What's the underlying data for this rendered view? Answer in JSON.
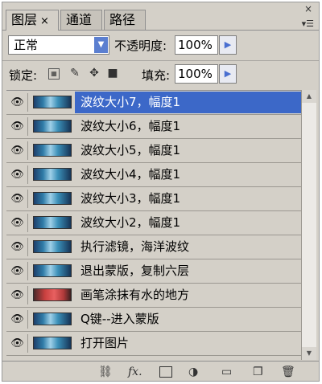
{
  "tabs": [
    {
      "label": "图层",
      "close": "×"
    },
    {
      "label": "通道"
    },
    {
      "label": "路径"
    }
  ],
  "panel_close": "×",
  "panel_menu": "▾☰",
  "blend_mode": {
    "value": "正常"
  },
  "opacity": {
    "label": "不透明度:",
    "value": "100%"
  },
  "lock": {
    "label": "锁定:"
  },
  "fill": {
    "label": "填充:",
    "value": "100%"
  },
  "layers": [
    {
      "name": "波纹大小7，幅度1",
      "selected": true
    },
    {
      "name": "波纹大小6，幅度1"
    },
    {
      "name": "波纹大小5，幅度1"
    },
    {
      "name": "波纹大小4，幅度1"
    },
    {
      "name": "波纹大小3，幅度1"
    },
    {
      "name": "波纹大小2，幅度1"
    },
    {
      "name": "执行滤镜，海洋波纹"
    },
    {
      "name": "退出蒙版，复制六层"
    },
    {
      "name": "画笔涂抹有水的地方",
      "thumb": "red"
    },
    {
      "name": "Q键--进入蒙版"
    },
    {
      "name": "打开图片"
    }
  ],
  "bottom_icons": {
    "fx": "fx."
  }
}
